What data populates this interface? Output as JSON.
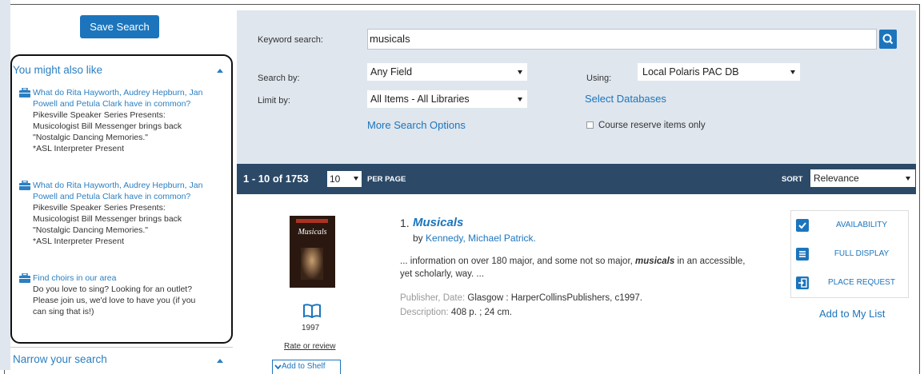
{
  "sidebar": {
    "save_search_label": "Save Search",
    "you_might_also_like": {
      "title": "You might also like",
      "items": [
        {
          "link": "What do Rita Hayworth, Audrey Hepburn, Jan Powell and Petula Clark have in common?",
          "lines": [
            "Pikesville Speaker Series Presents:",
            "Musicologist Bill Messenger brings back",
            "\"Nostalgic Dancing Memories.\"",
            "*ASL Interpreter Present"
          ]
        },
        {
          "link": "What do Rita Hayworth, Audrey Hepburn, Jan Powell and Petula Clark have in common?",
          "lines": [
            "Pikesville Speaker Series Presents:",
            "Musicologist Bill Messenger brings back",
            "\"Nostalgic Dancing Memories.\"",
            "*ASL Interpreter Present"
          ]
        },
        {
          "link": "Find choirs in our area",
          "lines": [
            "Do you love to sing? Looking for an outlet?",
            "Please join us, we'd love to have you (if you",
            "can sing that is!)"
          ]
        }
      ]
    },
    "narrow_title": "Narrow your search"
  },
  "search": {
    "keyword_label": "Keyword search:",
    "keyword_value": "musicals",
    "search_by_label": "Search by:",
    "search_by_value": "Any Field",
    "limit_by_label": "Limit by:",
    "limit_by_value": "All Items - All Libraries",
    "using_label": "Using:",
    "using_value": "Local Polaris PAC DB",
    "select_databases": "Select Databases",
    "more_options": "More Search Options",
    "course_reserve": "Course reserve items only"
  },
  "results_bar": {
    "count": "1 - 10 of 1753",
    "per_page_value": "10",
    "per_page_label": "PER PAGE",
    "sort_label": "SORT",
    "sort_value": "Relevance"
  },
  "result": {
    "number": "1.",
    "title": "Musicals",
    "by_prefix": "by",
    "author": "Kennedy, Michael Patrick.",
    "snippet_pre": "... information on over 180 major, and some not so major, ",
    "snippet_em": "musicals",
    "snippet_post": " in an accessible,",
    "snippet_line2": "yet scholarly, way. ...",
    "publisher_label": "Publisher, Date:",
    "publisher_value": "Glasgow : HarperCollinsPublishers, c1997.",
    "description_label": "Description:",
    "description_value": "408 p. ; 24 cm.",
    "cover_title": "Musicals",
    "year": "1997",
    "rate_review": "Rate or review",
    "add_to_shelf": "Add to Shelf",
    "actions": {
      "availability": "AVAILABILITY",
      "full_display": "FULL DISPLAY",
      "place_request": "PLACE REQUEST"
    },
    "add_to_list": "Add to My List"
  },
  "icons": {
    "search": "search-icon",
    "briefcase": "briefcase-icon",
    "book": "open-book-icon",
    "check": "check-icon",
    "list": "list-icon",
    "request": "enter-icon"
  },
  "colors": {
    "accent": "#1c75bc",
    "results_bar": "#2c4a68",
    "panel_bg": "#dfe6ee"
  }
}
